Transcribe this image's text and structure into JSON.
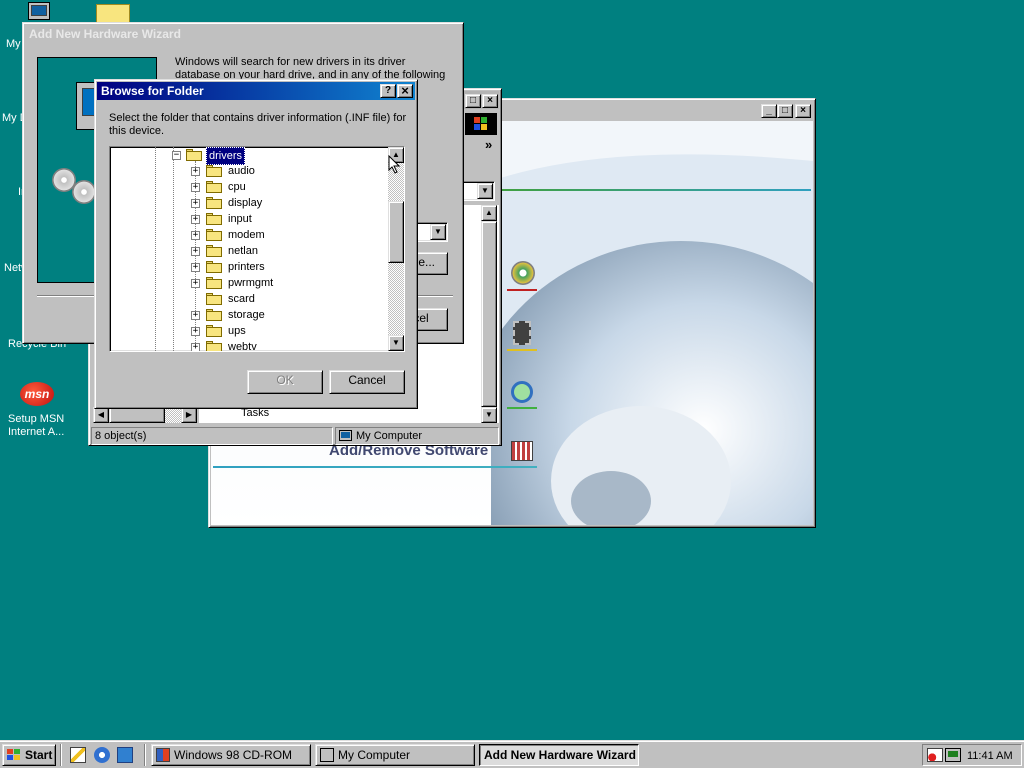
{
  "desktop": {
    "icons": [
      {
        "name": "my-computer",
        "label": "My Computer"
      },
      {
        "name": "my-documents",
        "label": "My Documents"
      },
      {
        "name": "internet-explorer",
        "label": "Internet Explorer"
      },
      {
        "name": "network-neighborhood",
        "label": "Network Neighborhood"
      },
      {
        "name": "recycle-bin",
        "label": "Recycle Bin"
      },
      {
        "name": "setup-msn",
        "label": "Setup MSN Internet A..."
      }
    ],
    "msn_logo_text": "msn"
  },
  "wizard": {
    "title": "Add New Hardware Wizard",
    "text": "Windows will search for new drivers in its driver database on your hard drive, and in any of the following selected",
    "browse_btn": "Browse...",
    "cancel_btn": "Cancel"
  },
  "explorer": {
    "status_count": "8 object(s)",
    "status_location": "My Computer",
    "side_item": "Tasks",
    "chevron": "»"
  },
  "cdrom": {
    "heading": "Add/Remove Software"
  },
  "browse_dialog": {
    "title": "Browse for Folder",
    "instruction": "Select the folder that contains driver information (.INF file) for this device.",
    "selected": "drivers",
    "folders": [
      {
        "label": "audio",
        "expander": "+"
      },
      {
        "label": "cpu",
        "expander": "+"
      },
      {
        "label": "display",
        "expander": "+"
      },
      {
        "label": "input",
        "expander": "+"
      },
      {
        "label": "modem",
        "expander": "+"
      },
      {
        "label": "netlan",
        "expander": "+"
      },
      {
        "label": "printers",
        "expander": "+"
      },
      {
        "label": "pwrmgmt",
        "expander": "+"
      },
      {
        "label": "scard",
        "expander": ""
      },
      {
        "label": "storage",
        "expander": "+"
      },
      {
        "label": "ups",
        "expander": "+"
      },
      {
        "label": "webtv",
        "expander": "+"
      }
    ],
    "ok_label": "OK",
    "cancel_label": "Cancel",
    "help_glyph": "?",
    "close_glyph": "×"
  },
  "taskbar": {
    "start_label": "Start",
    "tasks": [
      {
        "label": "Windows 98 CD-ROM",
        "active": false
      },
      {
        "label": "My Computer",
        "active": false
      },
      {
        "label": "Add New Hardware Wizard",
        "active": true
      }
    ],
    "clock": "11:41 AM"
  },
  "colors": {
    "desktop": "#008080",
    "title_active": "#000080",
    "face": "#c0c0c0"
  }
}
